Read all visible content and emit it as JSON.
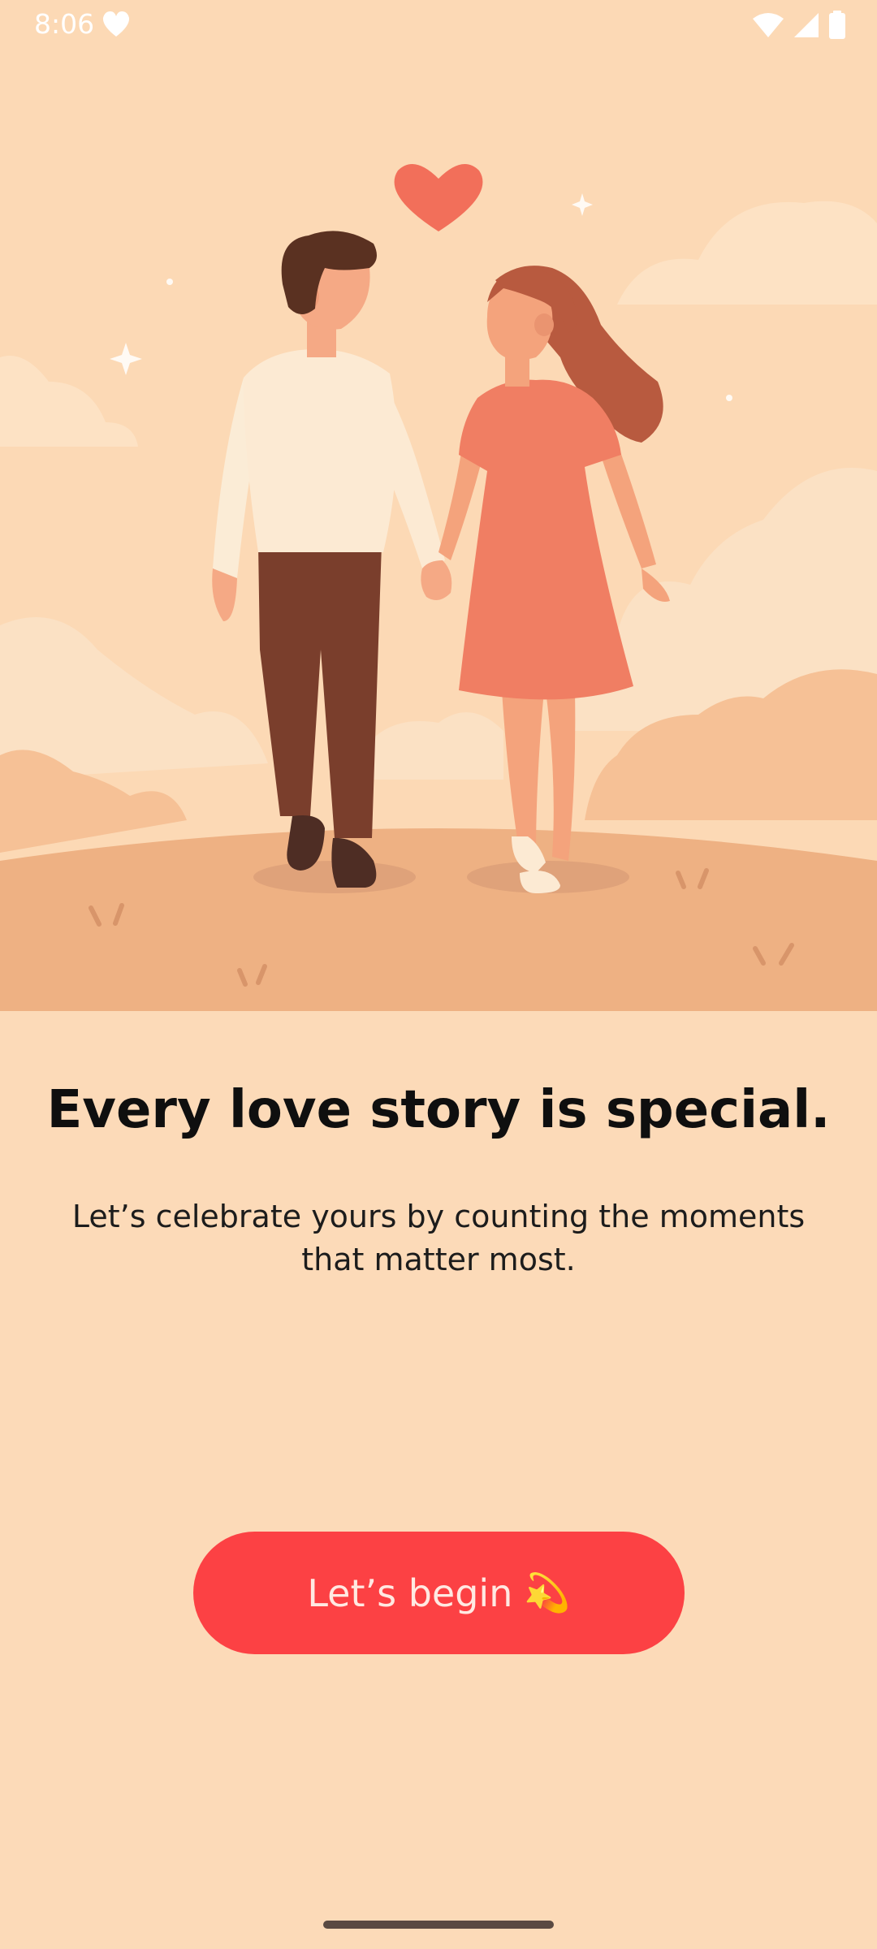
{
  "status_bar": {
    "time": "8:06",
    "left_icon": "heart-icon",
    "right_icons": [
      "wifi-icon",
      "signal-icon",
      "battery-icon"
    ]
  },
  "illustration": {
    "subject": "couple-holding-hands",
    "decorations": [
      "heart-icon",
      "sparkle-icon",
      "cloud"
    ]
  },
  "headline": "Every love story is special.",
  "subtext": "Let’s celebrate yours by counting the moments that matter most.",
  "cta": {
    "label": "Let’s begin",
    "icon": "💫"
  },
  "colors": {
    "background": "#fcdab8",
    "accent": "#fc4144",
    "button_text": "#ffe9e2"
  }
}
